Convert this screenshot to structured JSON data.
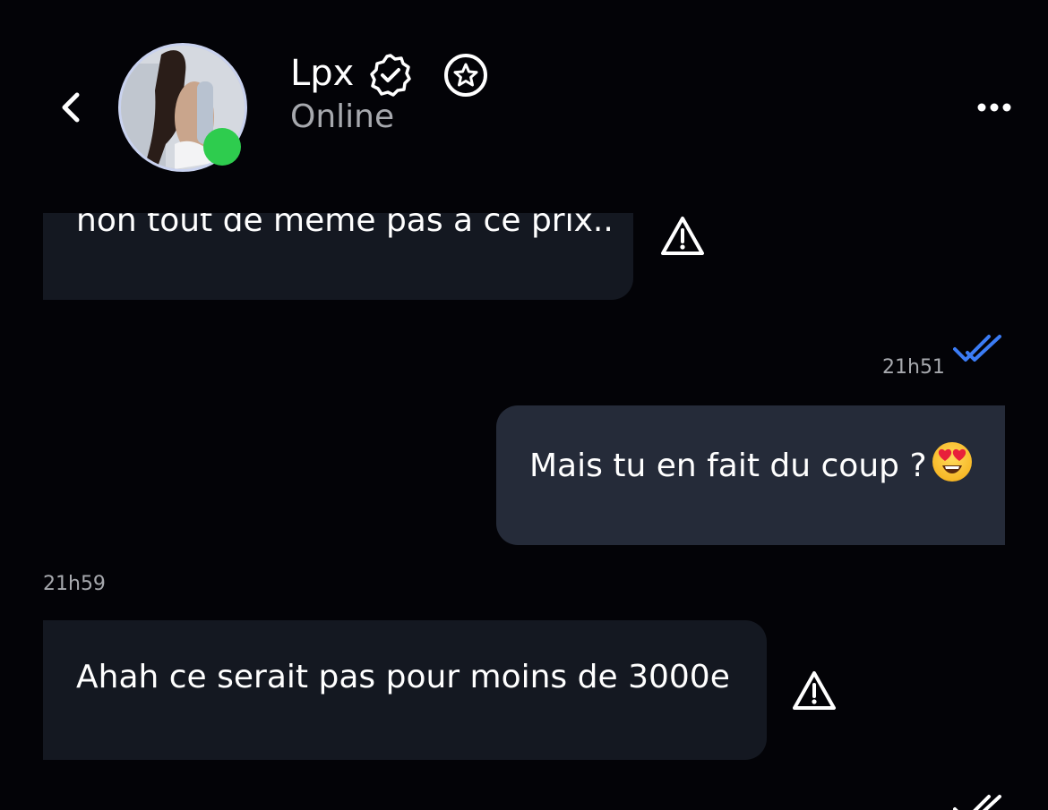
{
  "header": {
    "back_icon": "chevron-left-icon",
    "contact_name": "Lpx",
    "status": "Online",
    "verified_icon": "verified-badge-icon",
    "favorite_icon": "star-circle-icon",
    "menu_icon": "more-horizontal-icon",
    "online_color": "#2ecc4e"
  },
  "messages": [
    {
      "direction": "incoming",
      "text": "non tout de meme pas a ce prix..",
      "warning_icon": "warning-icon"
    },
    {
      "direction": "outgoing",
      "time": "21h51",
      "read_icon": "double-check-icon",
      "read_color": "#3b7cf5",
      "text": "Mais tu en fait du coup ?",
      "emoji": "heart-eyes-emoji"
    },
    {
      "direction": "incoming",
      "time": "21h59",
      "text": "Ahah ce serait pas pour moins de 3000e",
      "warning_icon": "warning-icon"
    }
  ],
  "colors": {
    "background": "#030307",
    "incoming_bubble": "#141821",
    "outgoing_bubble": "#252b39",
    "muted_text": "#a7a9ae"
  }
}
